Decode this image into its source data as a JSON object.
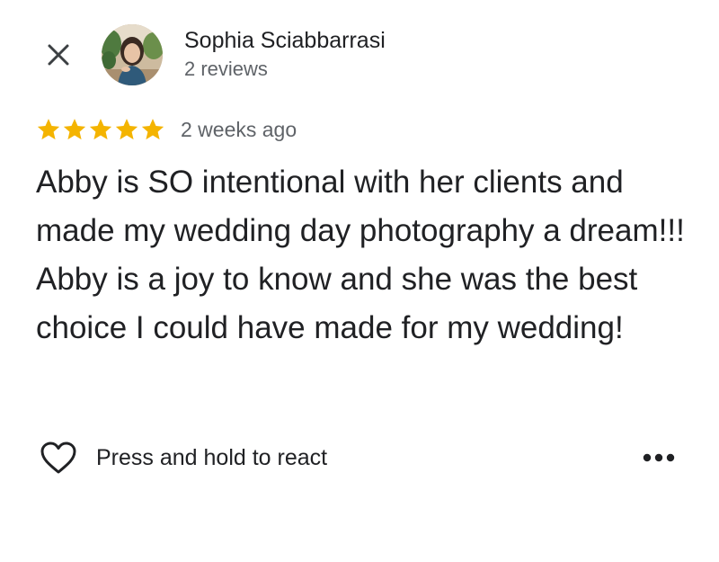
{
  "author": {
    "name": "Sophia Sciabbarrasi",
    "meta": "2 reviews"
  },
  "review": {
    "rating": 5,
    "rating_max": 5,
    "date": "2 weeks ago",
    "text": "Abby is SO intentional with her clients and made my wedding day photography a dream!!! Abby is a joy to know and she was the best choice I could have made for my wedding!"
  },
  "actions": {
    "react_label": "Press and hold to react"
  },
  "icons": {
    "close": "close-icon",
    "star": "star-icon",
    "heart": "heart-outline-icon",
    "more": "more-horizontal-icon"
  },
  "colors": {
    "star": "#F4B400",
    "text_primary": "#202124",
    "text_secondary": "#5f6368"
  }
}
